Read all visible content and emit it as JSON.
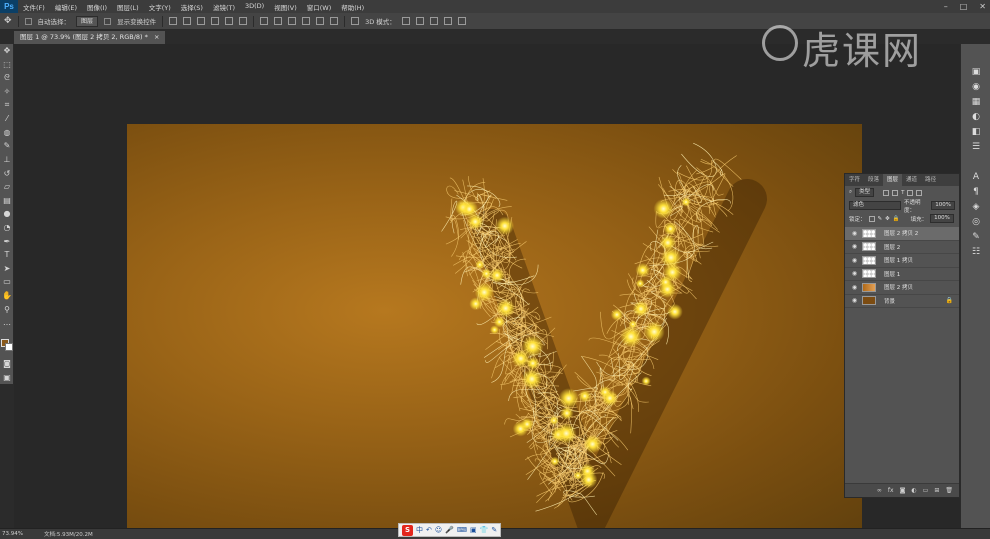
{
  "app": {
    "logo": "Ps"
  },
  "menu": [
    "文件(F)",
    "编辑(E)",
    "图像(I)",
    "图层(L)",
    "文字(Y)",
    "选择(S)",
    "滤镜(T)",
    "3D(D)",
    "视图(V)",
    "窗口(W)",
    "帮助(H)"
  ],
  "options": {
    "auto_select_label": "自动选择：",
    "auto_select_value": "图层",
    "transform_label": "显示变换控件",
    "mode_3d_label": "3D 模式："
  },
  "document_tab": {
    "title": "图层 1 @ 73.9% (图层 2 拷贝 2, RGB/8) *"
  },
  "watermark": {
    "text": "虎课网"
  },
  "layers_panel": {
    "tabs": [
      "字符",
      "段落",
      "图层",
      "通道",
      "路径"
    ],
    "active_tab": "图层",
    "filter_kind": "类型",
    "blend_mode": "滤色",
    "opacity_label": "不透明度：",
    "opacity_value": "100%",
    "lock_label": "锁定：",
    "fill_label": "填充：",
    "fill_value": "100%",
    "layers": [
      {
        "name": "图层 2 拷贝 2",
        "thumb": "transparent",
        "selected": true
      },
      {
        "name": "图层 2",
        "thumb": "transparent",
        "selected": false
      },
      {
        "name": "图层 1 拷贝",
        "thumb": "transparent",
        "selected": false
      },
      {
        "name": "图层 1",
        "thumb": "transparent",
        "selected": false
      },
      {
        "name": "图层 2 拷贝",
        "thumb": "photo",
        "selected": false
      },
      {
        "name": "背景",
        "thumb": "solid",
        "selected": false,
        "locked": true
      }
    ]
  },
  "status": {
    "zoom": "73.94%",
    "doc_size": "文档:5.93M/20.2M"
  },
  "ime": {
    "logo": "S",
    "lang": "中"
  },
  "colors": {
    "foreground": "#8a5a1c",
    "background": "#ffffff",
    "canvas_center": "#b6781f",
    "canvas_edge": "#60400d",
    "glow": "#ffe23a"
  }
}
